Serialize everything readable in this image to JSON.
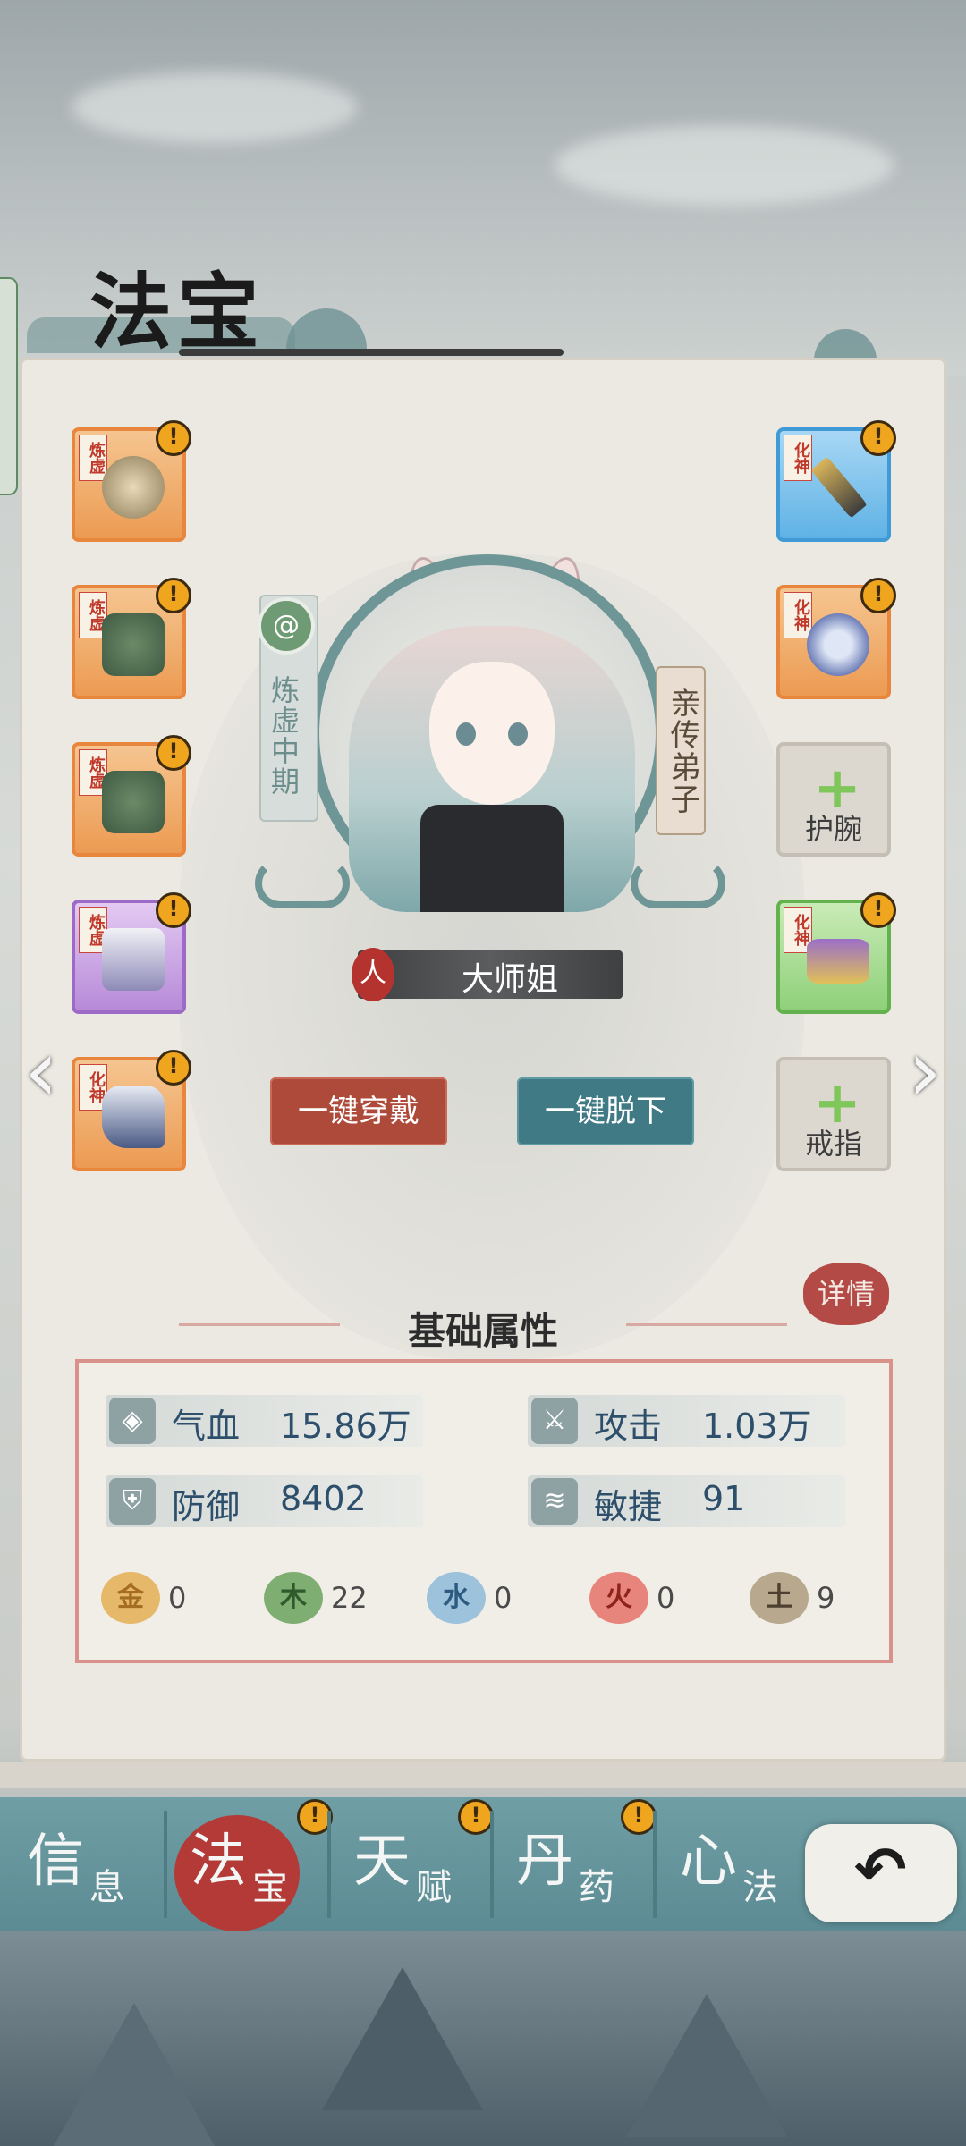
{
  "header": {
    "title": "法宝"
  },
  "left_slots": [
    {
      "rank": "炼虚",
      "color": "orange",
      "item_icon": "lantern-icon"
    },
    {
      "rank": "炼虚",
      "color": "orange",
      "item_icon": "cauldron-icon"
    },
    {
      "rank": "炼虚",
      "color": "orange",
      "item_icon": "cauldron-icon"
    },
    {
      "rank": "炼虚",
      "color": "purple",
      "item_icon": "robe-icon"
    },
    {
      "rank": "化神",
      "color": "orange",
      "item_icon": "boot-icon"
    }
  ],
  "right_slots": [
    {
      "rank": "化神",
      "color": "blue",
      "item_icon": "staff-icon"
    },
    {
      "rank": "化神",
      "color": "orange",
      "item_icon": "necklace-icon"
    },
    {
      "empty": true,
      "label": "护腕"
    },
    {
      "rank": "化神",
      "color": "green",
      "item_icon": "belt-icon"
    },
    {
      "empty": true,
      "label": "戒指"
    }
  ],
  "alert_mark": "!",
  "plus_mark": "+",
  "character": {
    "realm": "炼虚中期",
    "role": "亲传弟子",
    "race": "人",
    "name": "大师姐"
  },
  "buttons": {
    "equip_all": "一键穿戴",
    "unequip_all": "一键脱下"
  },
  "nav_arrows": {
    "prev": "‹",
    "next": "›"
  },
  "attributes": {
    "section_title": "基础属性",
    "detail": "详情",
    "stats": [
      {
        "label": "气血",
        "value": "15.86万",
        "icon": "blood-drop-icon"
      },
      {
        "label": "攻击",
        "value": "1.03万",
        "icon": "sword-icon"
      },
      {
        "label": "防御",
        "value": "8402",
        "icon": "shield-icon"
      },
      {
        "label": "敏捷",
        "value": "91",
        "icon": "wing-icon"
      }
    ],
    "elements": [
      {
        "glyph": "金",
        "value": "0",
        "color": "#e6b86a"
      },
      {
        "glyph": "木",
        "value": "22",
        "color": "#7fae72"
      },
      {
        "glyph": "水",
        "value": "0",
        "color": "#9cc2dc"
      },
      {
        "glyph": "火",
        "value": "0",
        "color": "#e7857d"
      },
      {
        "glyph": "土",
        "value": "9",
        "color": "#b7a88e"
      }
    ]
  },
  "bottom_nav": [
    {
      "big": "信",
      "small": "息",
      "alert": false,
      "active": false
    },
    {
      "big": "法",
      "small": "宝",
      "alert": true,
      "active": true
    },
    {
      "big": "天",
      "small": "赋",
      "alert": true,
      "active": false
    },
    {
      "big": "丹",
      "small": "药",
      "alert": true,
      "active": false
    },
    {
      "big": "心",
      "small": "法",
      "alert": false,
      "active": false
    }
  ],
  "back_icon": "back-arrow-icon",
  "back_glyph": "↶"
}
